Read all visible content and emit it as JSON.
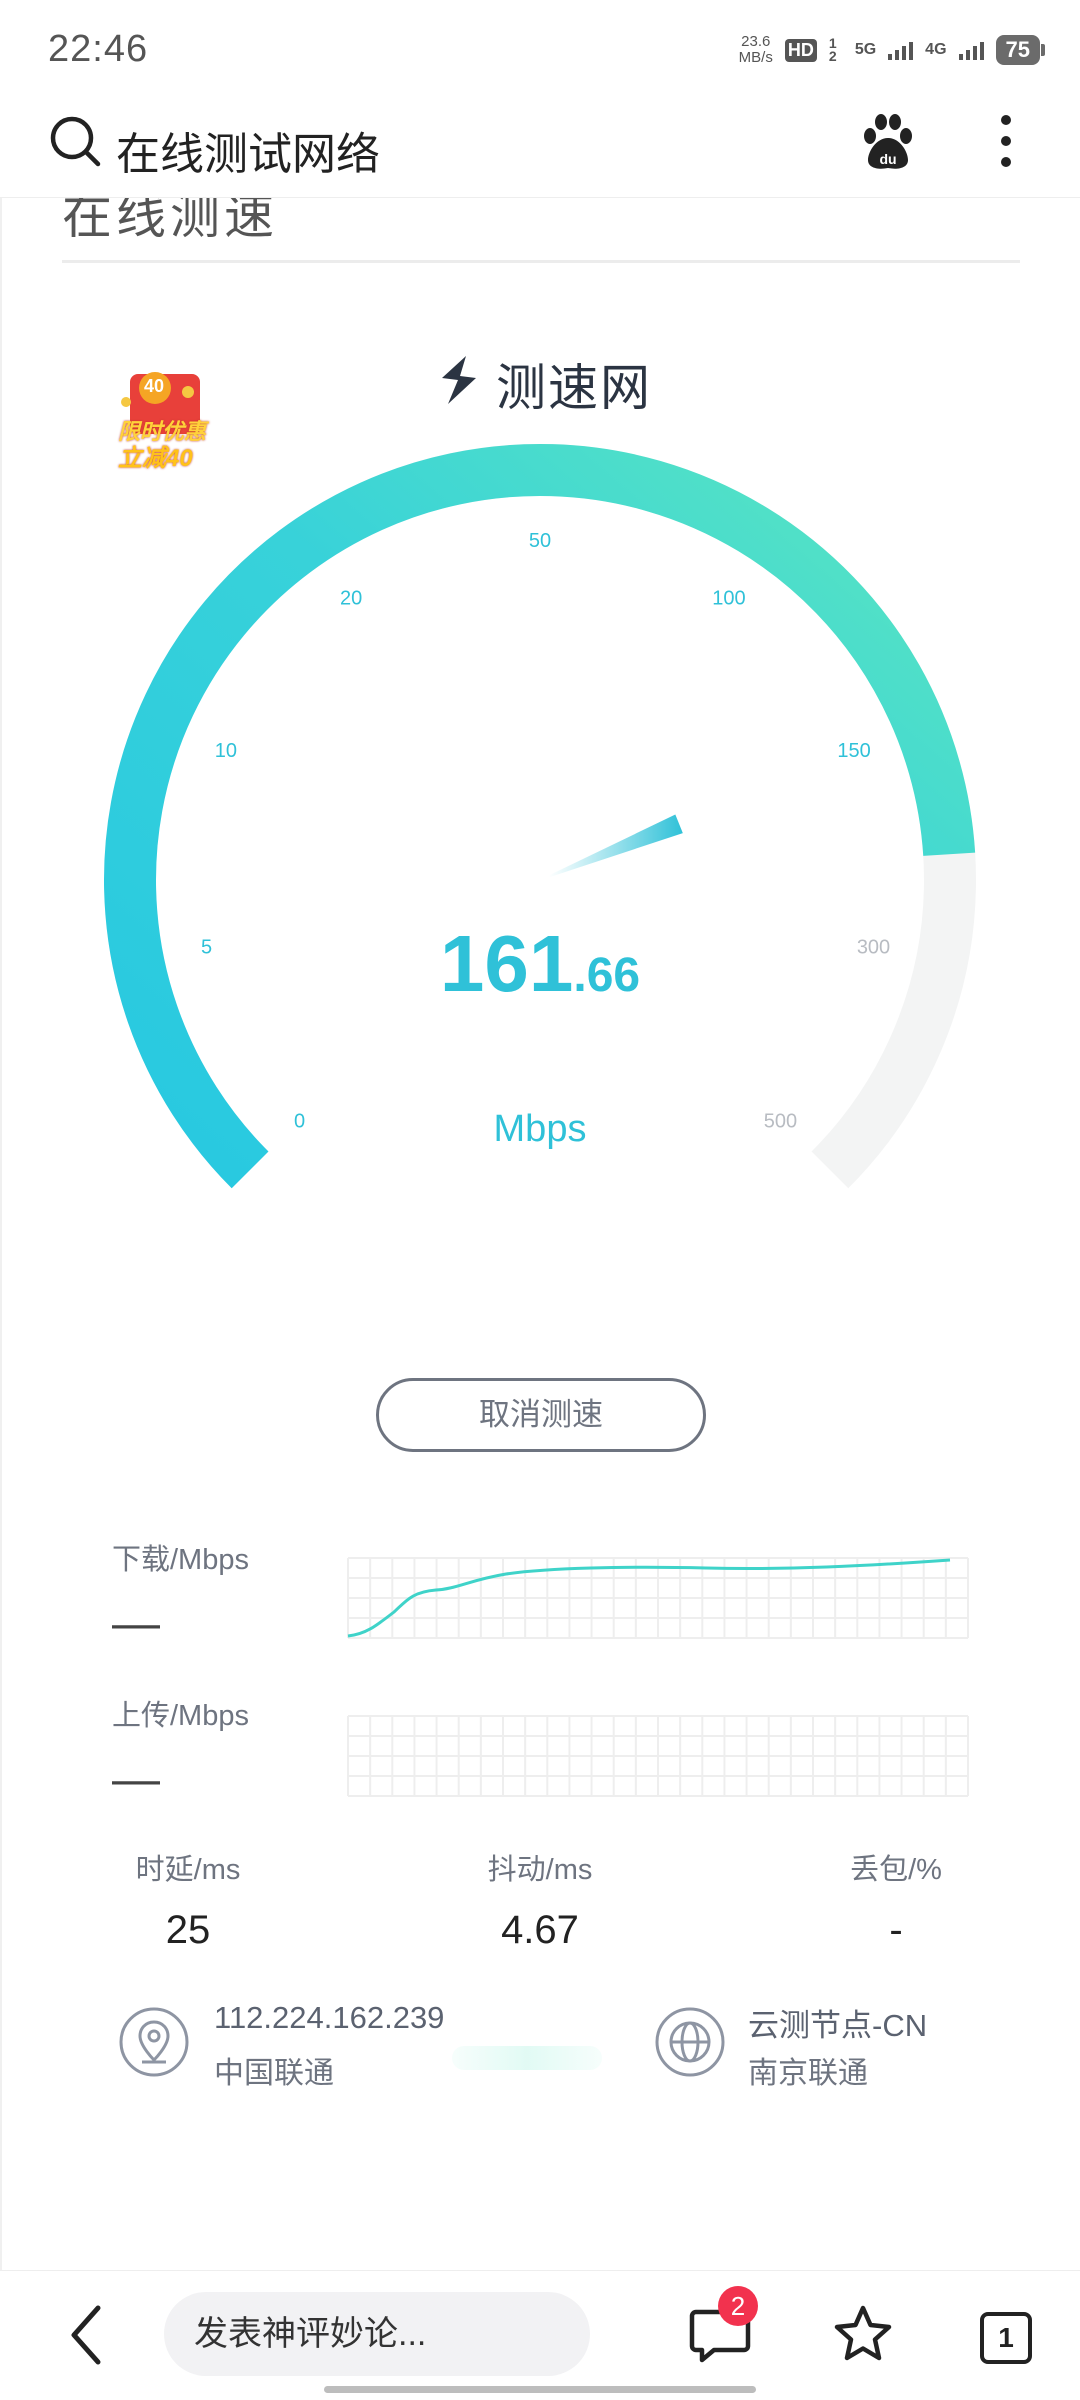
{
  "status_bar": {
    "time": "22:46",
    "net_speed": "23.6",
    "net_speed_unit": "MB/s",
    "hd_label": "HD",
    "sim_marks": "1 2",
    "sig1": "5G",
    "sig2": "4G",
    "battery": "75"
  },
  "header": {
    "title": "在线测试网络",
    "search_icon": "search-icon",
    "baidu_icon": "baidu-paw-icon",
    "more_icon": "more-vertical-icon"
  },
  "section": {
    "title": "在线测速"
  },
  "promo": {
    "top": "40",
    "line1": "限时优惠",
    "line2": "立减40"
  },
  "brand": {
    "name": "测速网",
    "icon": "speedtest-logo-icon"
  },
  "gauge": {
    "ticks": [
      "0",
      "5",
      "10",
      "20",
      "50",
      "100",
      "150",
      "300",
      "500"
    ],
    "speed_int": "161",
    "speed_dec": ".66",
    "unit": "Mbps",
    "progress_fraction": 0.82,
    "colors": {
      "start": "#29c9e0",
      "end": "#56e3c1",
      "track": "#f3f4f4",
      "text": "#2fc1d8"
    }
  },
  "actions": {
    "cancel": "取消测速"
  },
  "download": {
    "label": "下载/Mbps",
    "value": "—"
  },
  "upload": {
    "label": "上传/Mbps",
    "value": "—"
  },
  "metrics": [
    {
      "label": "时延/ms",
      "value": "25"
    },
    {
      "label": "抖动/ms",
      "value": "4.67"
    },
    {
      "label": "丢包/%",
      "value": "-"
    }
  ],
  "client": {
    "ip": "112.224.162.239",
    "isp": "中国联通",
    "icon": "location-pin-icon"
  },
  "server": {
    "node": "云测节点-CN",
    "isp": "南京联通",
    "icon": "globe-icon"
  },
  "bottom_bar": {
    "comment_placeholder": "发表神评妙论...",
    "comment_badge": "2",
    "tab_count": "1"
  }
}
